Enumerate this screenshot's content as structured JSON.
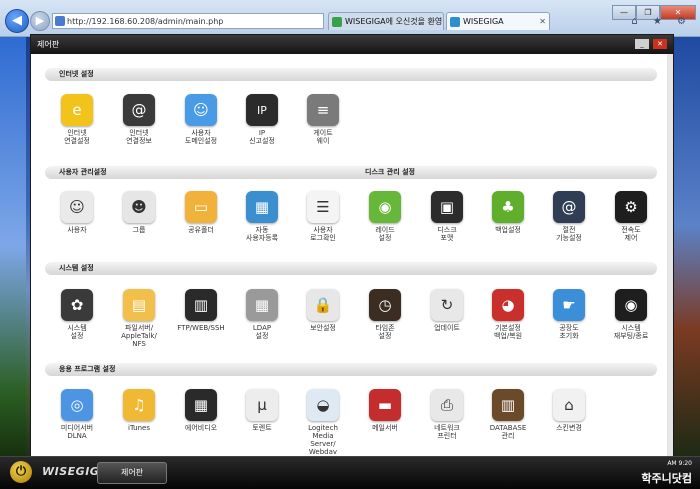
{
  "browser": {
    "url": "http://192.168.60.208/admin/main.php",
    "addr_tools": "▾ ⊠ ↻ ✕",
    "tabs": [
      {
        "label": "WISEGIGA에 오신것을 환영..."
      },
      {
        "label": "WISEGIGA"
      }
    ],
    "tab_close": "✕",
    "window_controls": [
      "—",
      "❐",
      "✕"
    ],
    "right_icons": "⌂ ★ ⚙"
  },
  "panel": {
    "title": "제어판",
    "min_label": "_",
    "close_label": "✕",
    "sections": [
      {
        "title": "인터넷 설정",
        "items": [
          {
            "label": "인터넷\n연결설정",
            "icon": "internet-setup-icon",
            "color": "#f2c31b",
            "glyph": "e"
          },
          {
            "label": "인터넷\n연결정보",
            "icon": "connection-info-icon",
            "color": "#3a3a3a",
            "glyph": "@"
          },
          {
            "label": "사용자\n도메인설정",
            "icon": "finder-icon",
            "color": "#4a9be6",
            "glyph": "☺"
          },
          {
            "label": "IP\n신고설정",
            "icon": "ip-report-icon",
            "color": "#2b2b2b",
            "glyph": "IP"
          },
          {
            "label": "게이트\n웨이",
            "icon": "gateway-icon",
            "color": "#7a7a7a",
            "glyph": "≡"
          }
        ]
      },
      {
        "title": "사용자 관리설정",
        "title2": "디스크 관리 설정",
        "items": [
          {
            "label": "사용자",
            "icon": "user-icon",
            "color": "#eaeaea",
            "glyph": "☺"
          },
          {
            "label": "그룹",
            "icon": "group-icon",
            "color": "#e6e6e6",
            "glyph": "☻"
          },
          {
            "label": "공유폴더",
            "icon": "shared-folder-icon",
            "color": "#f0b23a",
            "glyph": "▭"
          },
          {
            "label": "자동\n사용자등록",
            "icon": "auto-register-icon",
            "color": "#3c8fcf",
            "glyph": "▦"
          },
          {
            "label": "사용자\n로그확인",
            "icon": "user-log-icon",
            "color": "#f4f4f4",
            "glyph": "☰"
          },
          {
            "label": "레이드\n설정",
            "icon": "raid-icon",
            "color": "#67b83a",
            "glyph": "◉"
          },
          {
            "label": "디스크\n포맷",
            "icon": "disk-format-icon",
            "color": "#2c2c2c",
            "glyph": "▣"
          },
          {
            "label": "백업설정",
            "icon": "backup-icon",
            "color": "#5fae2c",
            "glyph": "♣"
          },
          {
            "label": "절전\n기능설정",
            "icon": "power-save-icon",
            "color": "#2f3e55",
            "glyph": "@"
          },
          {
            "label": "전속도\n제어",
            "icon": "speed-control-icon",
            "color": "#1e1e1e",
            "glyph": "⚙"
          }
        ]
      },
      {
        "title": "시스템 설정",
        "items": [
          {
            "label": "시스템\n설정",
            "icon": "system-settings-icon",
            "color": "#3a3a3a",
            "glyph": "✿"
          },
          {
            "label": "파일서버/\nAppleTalk/\nNFS",
            "icon": "file-server-icon",
            "color": "#f2c04a",
            "glyph": "▤"
          },
          {
            "label": "FTP/WEB/SSH",
            "icon": "ftp-icon",
            "color": "#2a2a2a",
            "glyph": "▥"
          },
          {
            "label": "LDAP\n설정",
            "icon": "ldap-icon",
            "color": "#9a9a9a",
            "glyph": "▦"
          },
          {
            "label": "보안설정",
            "icon": "security-lock-icon",
            "color": "#e7e7e7",
            "glyph": "🔒"
          },
          {
            "label": "타임존\n설정",
            "icon": "timezone-clock-icon",
            "color": "#3b2d22",
            "glyph": "◷"
          },
          {
            "label": "업데이트",
            "icon": "update-icon",
            "color": "#e8e8e8",
            "glyph": "↻"
          },
          {
            "label": "기본설정\n백업/복원",
            "icon": "backup-restore-icon",
            "color": "#c9302c",
            "glyph": "◕"
          },
          {
            "label": "공장도\n초기화",
            "icon": "factory-reset-icon",
            "color": "#3b8fd8",
            "glyph": "☛"
          },
          {
            "label": "시스템\n재부팅/종료",
            "icon": "reboot-icon",
            "color": "#1e1e1e",
            "glyph": "◉"
          }
        ]
      },
      {
        "title": "응용 프로그램 설정",
        "items": [
          {
            "label": "미디어서버\nDLNA",
            "icon": "media-server-icon",
            "color": "#4d95e3",
            "glyph": "◎"
          },
          {
            "label": "iTunes",
            "icon": "itunes-icon",
            "color": "#f0b933",
            "glyph": "♫"
          },
          {
            "label": "에어비디오",
            "icon": "air-video-icon",
            "color": "#2a2a2a",
            "glyph": "▦"
          },
          {
            "label": "토렌트",
            "icon": "torrent-icon",
            "color": "#ededed",
            "glyph": "µ"
          },
          {
            "label": "Logitech\nMedia\nServer/\nWebdav",
            "icon": "logitech-media-icon",
            "color": "#dfe9f4",
            "glyph": "◒"
          },
          {
            "label": "메일서버",
            "icon": "mail-server-icon",
            "color": "#c42d2d",
            "glyph": "▬"
          },
          {
            "label": "네트워크\n프린터",
            "icon": "network-printer-icon",
            "color": "#e8e8e8",
            "glyph": "⎙"
          },
          {
            "label": "DATABASE\n관리",
            "icon": "database-icon",
            "color": "#6b4a2a",
            "glyph": "▥"
          },
          {
            "label": "스킨변경",
            "icon": "skin-change-icon",
            "color": "#f1f1f1",
            "glyph": "⌂"
          }
        ]
      }
    ]
  },
  "taskbar": {
    "power_glyph": "⏻",
    "brand": "WISEGIGA",
    "task_label": "제어판",
    "clock": "AM 9:20",
    "watermark": "학주니닷컴"
  }
}
